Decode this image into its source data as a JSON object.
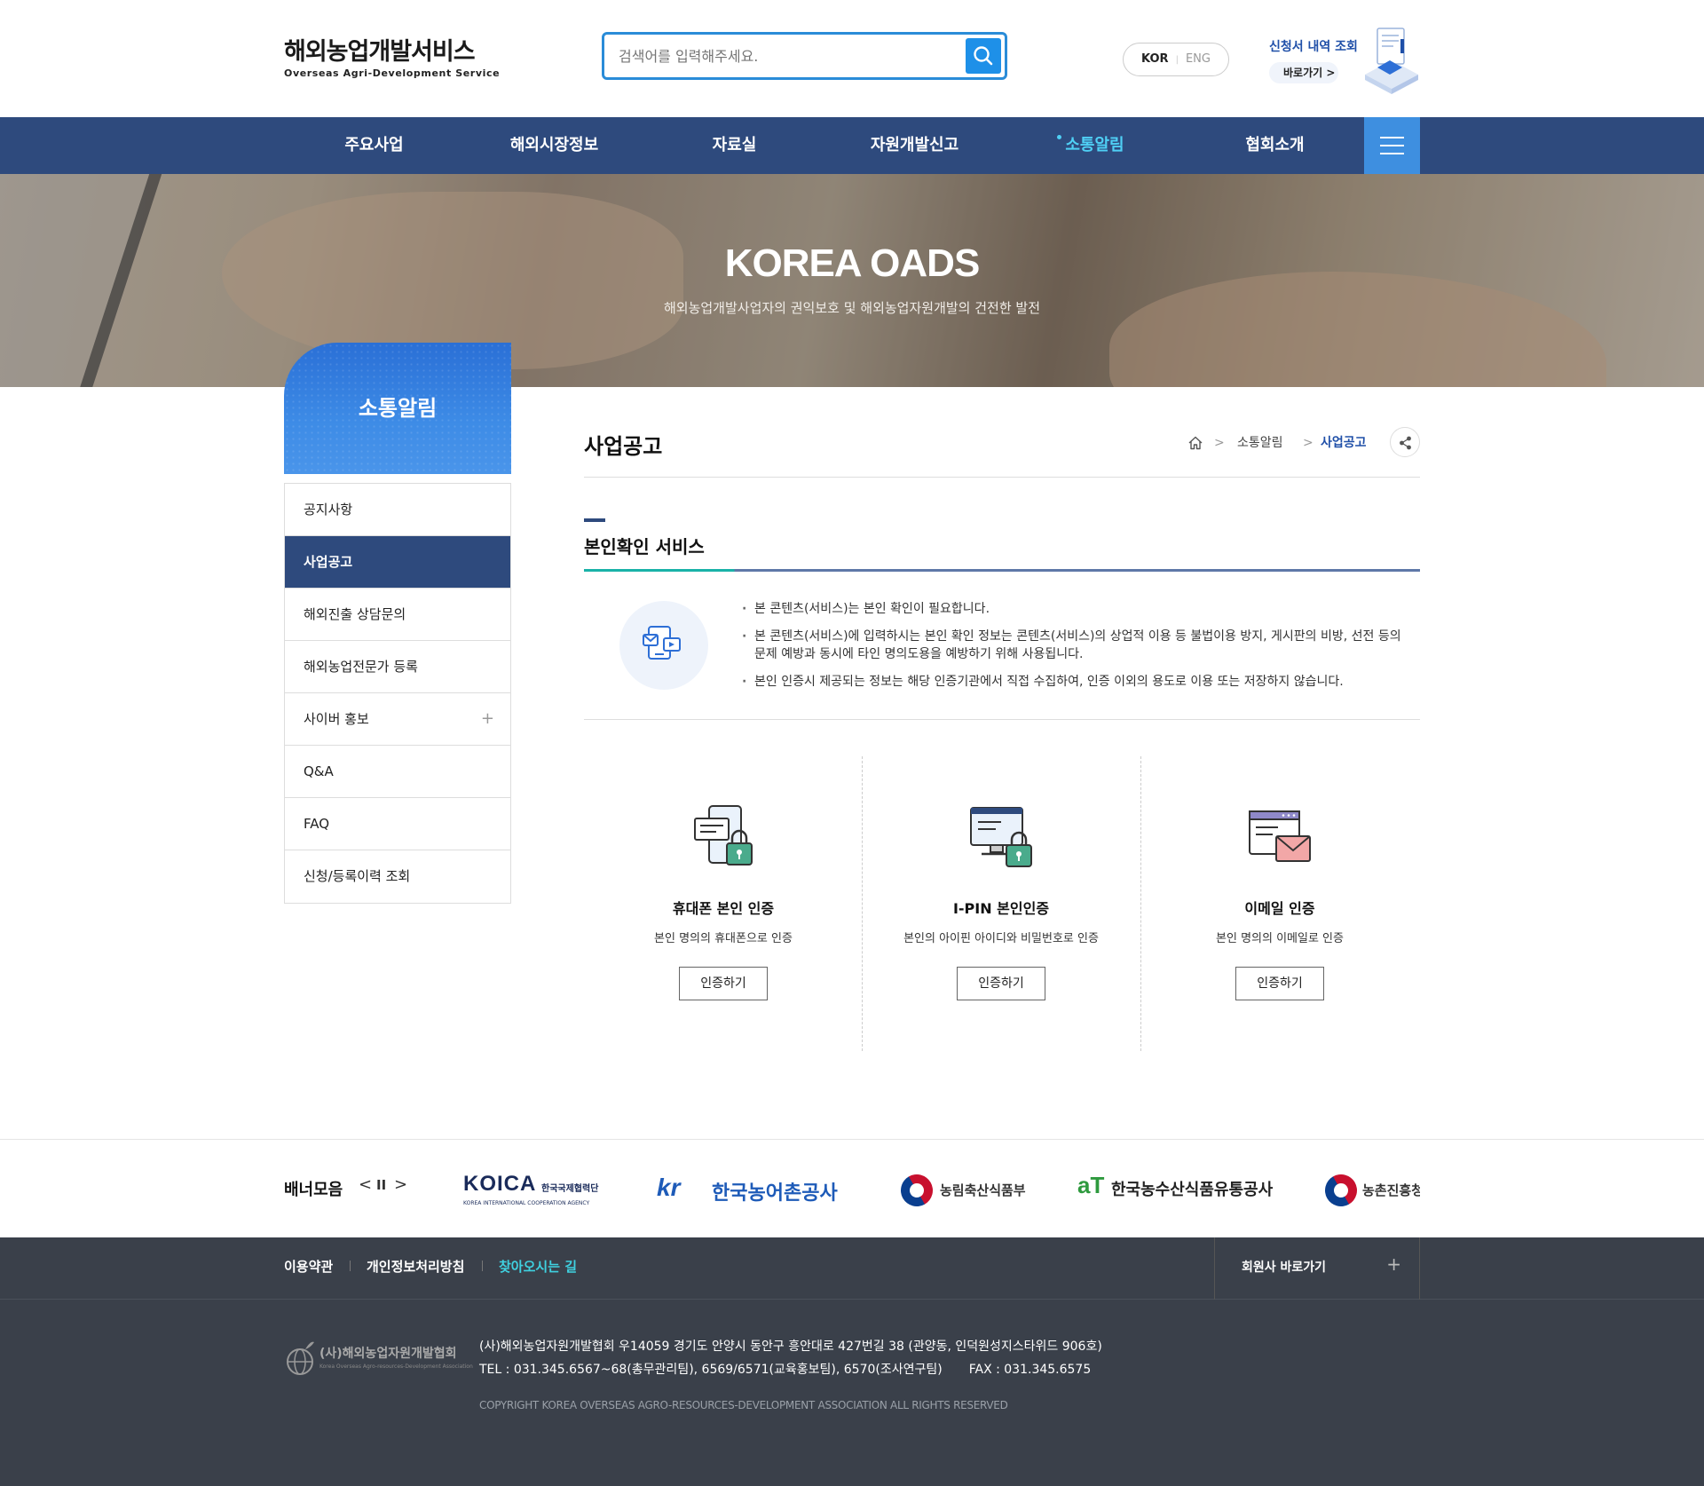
{
  "header": {
    "logo_ko": "해외농업개발서비스",
    "logo_en": "Overseas Agri-Development Service",
    "search_placeholder": "검색어를 입력해주세요.",
    "lang_kor": "KOR",
    "lang_eng": "ENG",
    "apply_title": "신청서 내역 조회",
    "apply_link": "바로가기 >"
  },
  "nav": {
    "items": [
      "주요사업",
      "해외시장정보",
      "자료실",
      "자원개발신고",
      "소통알림",
      "협회소개"
    ],
    "active": "소통알림"
  },
  "hero": {
    "title": "KOREA OADS",
    "subtitle": "해외농업개발사업자의 권익보호 및 해외농업자원개발의 건전한 발전"
  },
  "sidebar": {
    "title": "소통알림",
    "items": [
      {
        "label": "공지사항"
      },
      {
        "label": "사업공고"
      },
      {
        "label": "해외진출 상담문의"
      },
      {
        "label": "해외농업전문가 등록"
      },
      {
        "label": "사이버 홍보"
      },
      {
        "label": "Q&A"
      },
      {
        "label": "FAQ"
      },
      {
        "label": "신청/등록이력 조회"
      }
    ],
    "active": "사업공고"
  },
  "content": {
    "page_title": "사업공고",
    "breadcrumb": [
      "소통알림",
      "사업공고"
    ],
    "section_title": "본인확인 서비스",
    "notices": [
      "본 콘텐츠(서비스)는 본인 확인이 필요합니다.",
      "본 콘텐츠(서비스)에 입력하시는 본인 확인 정보는 콘텐츠(서비스)의 상업적 이용 등 불법이용 방지, 게시판의 비방, 선전 등의 문제 예방과 동시에 타인 명의도용을 예방하기 위해 사용됩니다.",
      "본인 인증시 제공되는 정보는 해당 인증기관에서 직접 수집하여, 인증 이외의 용도로 이용 또는 저장하지 않습니다."
    ],
    "auth_methods": [
      {
        "title": "휴대폰 본인 인증",
        "desc": "본인 명의의 휴대폰으로 인증",
        "button": "인증하기",
        "icon": "phone-lock-icon"
      },
      {
        "title": "I-PIN 본인인증",
        "desc": "본인의 아이핀 아이디와 비밀번호로 인증",
        "button": "인증하기",
        "icon": "monitor-lock-icon"
      },
      {
        "title": "이메일 인증",
        "desc": "본인 명의의 이메일로 인증",
        "button": "인증하기",
        "icon": "email-window-icon"
      }
    ]
  },
  "banner": {
    "label": "배너모음",
    "controls": [
      "<",
      "II",
      ">"
    ],
    "logos": [
      {
        "main": "KOICA",
        "sub": "한국국제협력단",
        "sub2": "KOREA INTERNATIONAL COOPERATION AGENCY"
      },
      {
        "main": "kr",
        "sub": "한국농어촌공사"
      },
      {
        "main": "농림축산식품부"
      },
      {
        "main": "aT",
        "sub": "한국농수산식품유통공사"
      },
      {
        "main": "농촌진흥청"
      }
    ]
  },
  "footer": {
    "links": [
      "이용약관",
      "개인정보처리방침",
      "찾아오시는 길"
    ],
    "family_site": "회원사 바로가기",
    "family_plus": "+",
    "org_name": "(사)해외농업자원개발협회",
    "org_sub": "Korea Overseas Agro-resources-Development Association",
    "address": "(사)해외농업자원개발협회 우14059 경기도 안양시 동안구 흥안대로 427번길 38 (관양동, 인덕원성지스타위드 906호)",
    "tel": "TEL : 031.345.6567~68(총무관리팀), 6569/6571(교육홍보팀), 6570(조사연구팀)",
    "fax": "FAX : 031.345.6575",
    "copyright": "COPYRIGHT KOREA OVERSEAS AGRO-RESOURCES-DEVELOPMENT ASSOCIATION ALL RIGHTS RESERVED"
  },
  "colors": {
    "nav_bg": "#2e4a7d",
    "accent_blue": "#1e90e8",
    "active_cyan": "#4fd0f5",
    "footer_bg": "#3a404a"
  }
}
